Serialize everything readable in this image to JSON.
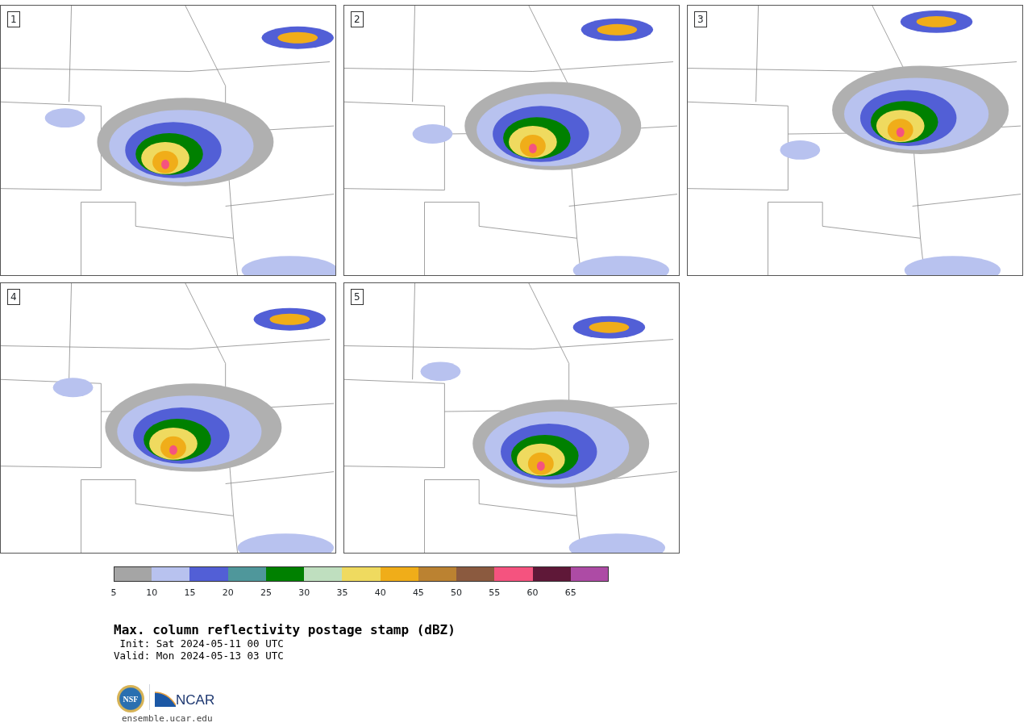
{
  "panels": [
    {
      "label": "1"
    },
    {
      "label": "2"
    },
    {
      "label": "3"
    },
    {
      "label": "4"
    },
    {
      "label": "5"
    }
  ],
  "colorbar": {
    "bins": [
      {
        "color": "#a5a5a5",
        "tick": "5"
      },
      {
        "color": "#b8c2ef",
        "tick": "10"
      },
      {
        "color": "#525fd6",
        "tick": "15"
      },
      {
        "color": "#4f979b",
        "tick": "20"
      },
      {
        "color": "#008000",
        "tick": "25"
      },
      {
        "color": "#bfdfbf",
        "tick": "30"
      },
      {
        "color": "#efda5f",
        "tick": "35"
      },
      {
        "color": "#f0ad19",
        "tick": "40"
      },
      {
        "color": "#bb8231",
        "tick": "45"
      },
      {
        "color": "#8b5a3f",
        "tick": "50"
      },
      {
        "color": "#f5537f",
        "tick": "55"
      },
      {
        "color": "#5f1838",
        "tick": "60"
      },
      {
        "color": "#ad4ba5",
        "tick": "65"
      }
    ]
  },
  "title": "Max. column reflectivity postage stamp (dBZ)",
  "init": " Init: Sat 2024-05-11 00 UTC",
  "valid": "Valid: Mon 2024-05-13 03 UTC",
  "logos": {
    "nsf": "NSF",
    "ncar": "NCAR"
  },
  "url": "ensemble.ucar.edu"
}
